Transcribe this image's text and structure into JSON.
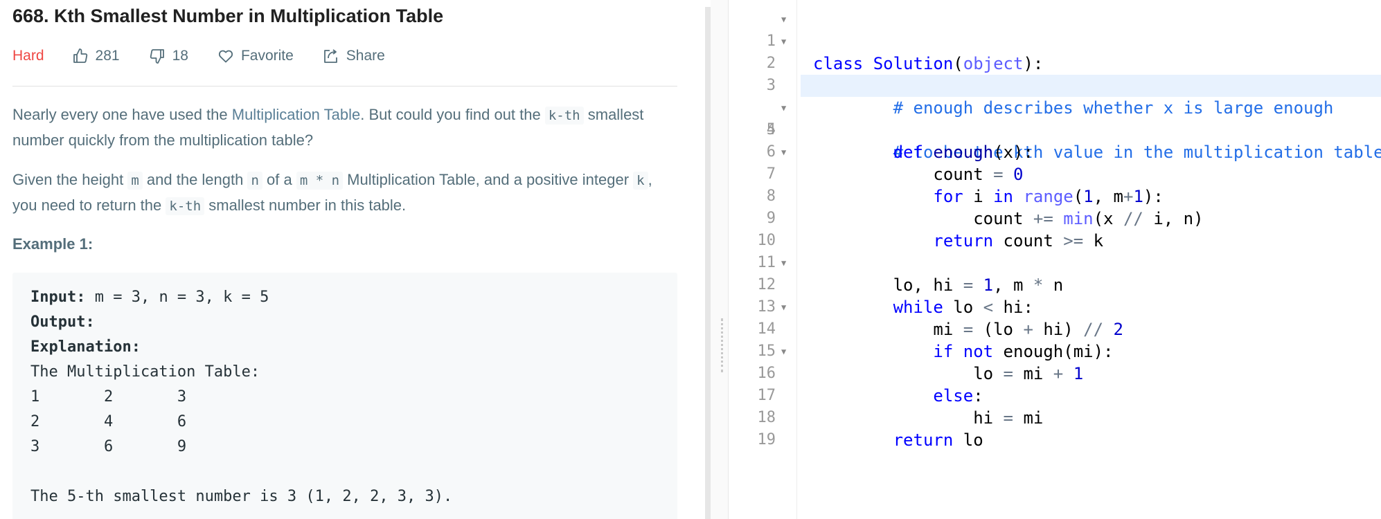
{
  "problem": {
    "title": "668. Kth Smallest Number in Multiplication Table",
    "difficulty": "Hard",
    "likes": "281",
    "dislikes": "18",
    "favorite_label": "Favorite",
    "share_label": "Share"
  },
  "description": {
    "p1_a": "Nearly every one have used the ",
    "p1_link": "Multiplication Table",
    "p1_b": ". But could you find out the ",
    "p1_code": "k-th",
    "p1_c": " smallest number quickly from the multiplication table?",
    "p2_a": "Given the height ",
    "p2_code1": "m",
    "p2_b": " and the length ",
    "p2_code2": "n",
    "p2_c": " of a ",
    "p2_code3": "m * n",
    "p2_d": " Multiplication Table, and a positive integer ",
    "p2_code4": "k",
    "p2_e": ", you need to return the ",
    "p2_code5": "k-th",
    "p2_f": " smallest number in this table."
  },
  "example": {
    "title": "Example 1:",
    "input_label": "Input:",
    "input_value": " m = 3, n = 3, k = 5",
    "output_label": "Output:",
    "explanation_label": "Explanation:",
    "table_heading": "The Multiplication Table:",
    "row1": "1\t2\t3",
    "row2": "2\t4\t6",
    "row3": "3\t6\t9",
    "conclusion": "The 5-th smallest number is 3 (1, 2, 2, 3, 3)."
  },
  "editor": {
    "line_numbers": [
      "1",
      "2",
      "3",
      "4",
      "5",
      "6",
      "7",
      "8",
      "9",
      "10",
      "11",
      "12",
      "13",
      "14",
      "15",
      "16",
      "17",
      "18",
      "19"
    ]
  }
}
